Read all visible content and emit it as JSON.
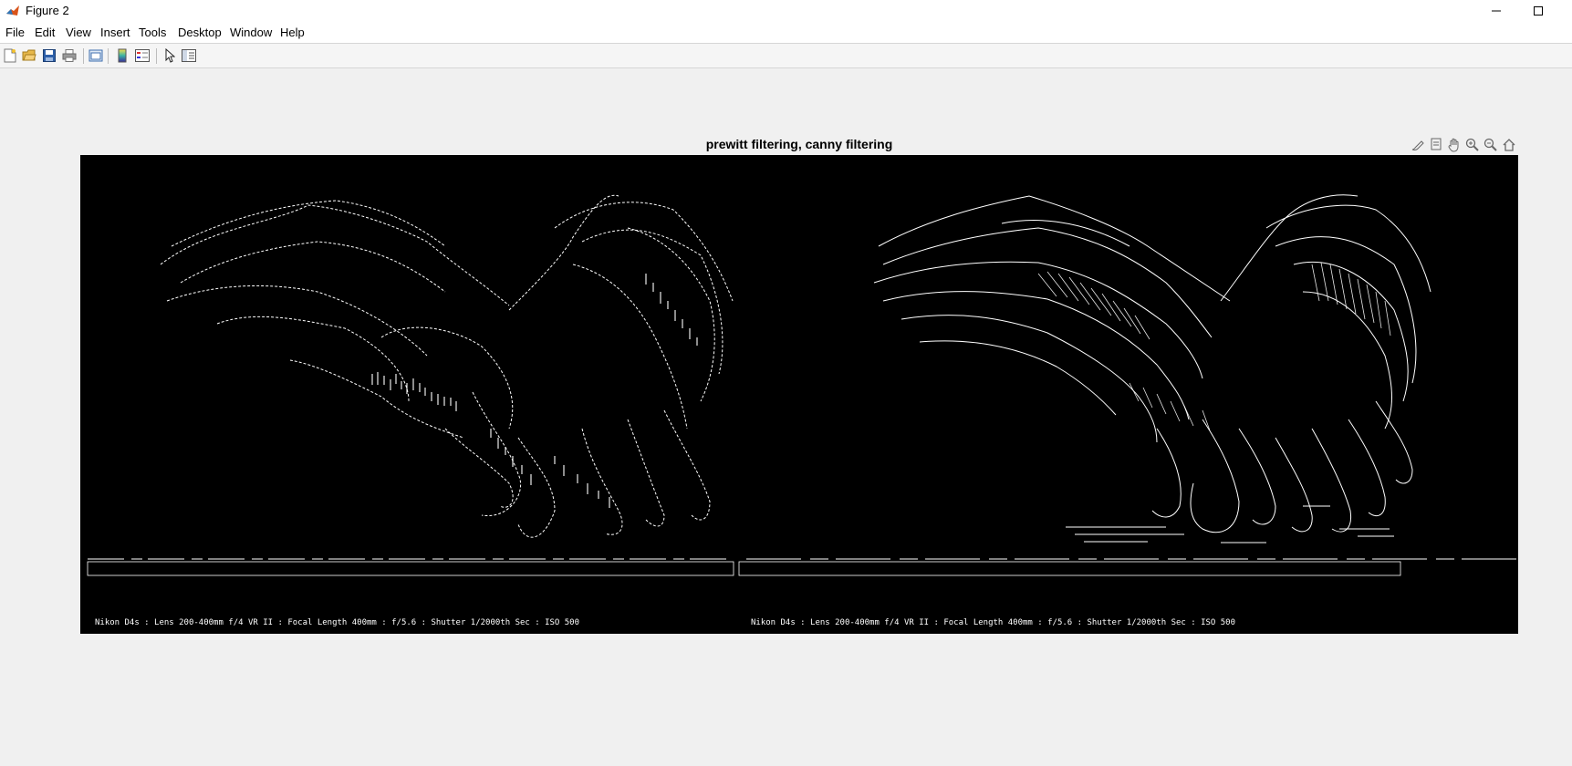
{
  "window": {
    "title": "Figure 2"
  },
  "menu": [
    "File",
    "Edit",
    "View",
    "Insert",
    "Tools",
    "Desktop",
    "Window",
    "Help"
  ],
  "toolbar_icons": [
    "new-figure-icon",
    "open-file-icon",
    "save-icon",
    "print-icon",
    "link-plot-icon",
    "insert-colorbar-icon",
    "insert-legend-icon",
    "edit-plot-icon",
    "property-inspector-icon"
  ],
  "axes_toolbar_icons": [
    "brush-icon",
    "data-tips-icon",
    "pan-icon",
    "zoom-in-icon",
    "zoom-out-icon",
    "home-icon"
  ],
  "figure": {
    "title": "prewitt filtering, canny filtering",
    "left_caption": "Nikon D4s : Lens 200-400mm f/4 VR II : Focal Length 400mm : f/5.6 : Shutter 1/2000th Sec : ISO 500",
    "right_caption": "Nikon D4s : Lens 200-400mm f/4 VR II : Focal Length 400mm : f/5.6 : Shutter 1/2000th Sec : ISO 500"
  }
}
